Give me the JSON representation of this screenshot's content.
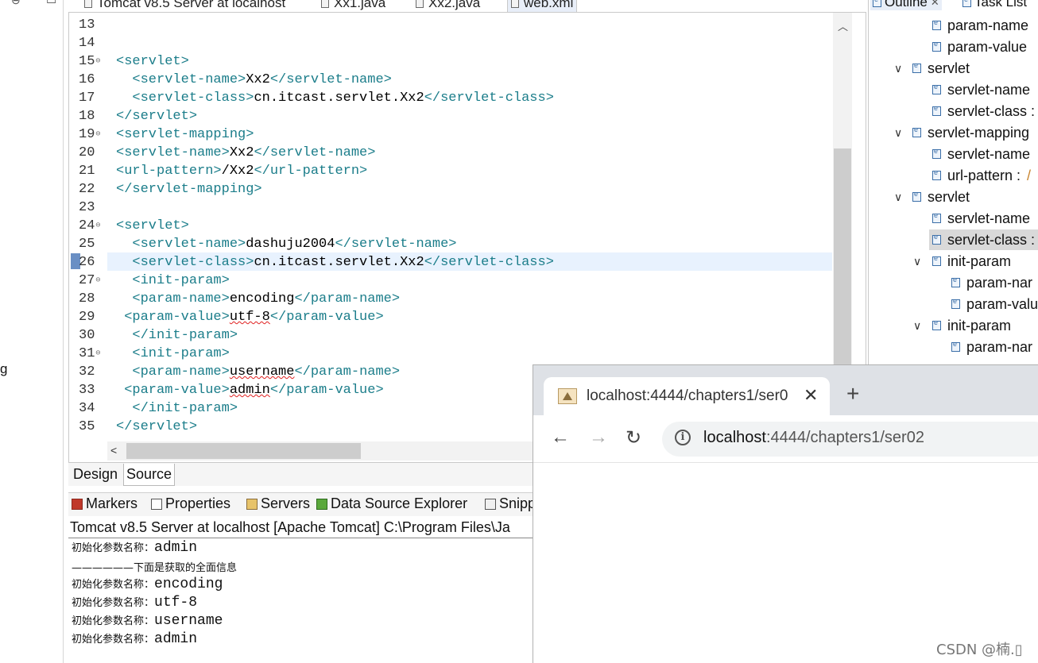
{
  "left_panel": {
    "cut_text": "g"
  },
  "editor_tabs": [
    {
      "label": "Tomcat v8.5 Server at localhost",
      "icon": "server-icon"
    },
    {
      "label": "Xx1.java",
      "icon": "java-file-icon"
    },
    {
      "label": "Xx2.java",
      "icon": "java-file-icon"
    },
    {
      "label": "web.xml",
      "icon": "xml-file-icon"
    }
  ],
  "editor": {
    "line_numbers": [
      "13",
      "14",
      "15",
      "16",
      "17",
      "18",
      "19",
      "20",
      "21",
      "22",
      "23",
      "24",
      "25",
      "26",
      "27",
      "28",
      "29",
      "30",
      "31",
      "32",
      "33",
      "34",
      "35"
    ],
    "fold_marker": "⊖",
    "lines": {
      "l15": {
        "t1": "<servlet>"
      },
      "l16": {
        "t1": "<servlet-name>",
        "v": "Xx2",
        "t2": "</servlet-name>"
      },
      "l17": {
        "t1": "<servlet-class>",
        "v": "cn.itcast.servlet.Xx2",
        "t2": "</servlet-class>"
      },
      "l18": {
        "t1": "</servlet>"
      },
      "l19": {
        "t1": "<servlet-mapping>"
      },
      "l20": {
        "t1": "<servlet-name>",
        "v": "Xx2",
        "t2": "</servlet-name>"
      },
      "l21": {
        "t1": "<url-pattern>",
        "v": "/Xx2",
        "t2": "</url-pattern>"
      },
      "l22": {
        "t1": "</servlet-mapping>"
      },
      "l24": {
        "t1": "<servlet>"
      },
      "l25": {
        "t1": "<servlet-name>",
        "v": "dashuju2004",
        "t2": "</servlet-name>"
      },
      "l26": {
        "t1": "<servlet-class>",
        "v": "cn.itcast.servlet.Xx2",
        "t2": "</servlet-class>"
      },
      "l27": {
        "t1": "<init-param>"
      },
      "l28": {
        "t1": "<param-name>",
        "v": "encoding",
        "t2": "</param-name>"
      },
      "l29": {
        "t1": "<param-value>",
        "v": "utf-8",
        "t2": "</param-value>"
      },
      "l30": {
        "t1": "</init-param>"
      },
      "l31": {
        "t1": "<init-param>"
      },
      "l32": {
        "t1": "<param-name>",
        "v": "username",
        "t2": "</param-name>"
      },
      "l33": {
        "t1": "<param-value>",
        "v": "admin",
        "t2": "</param-value>"
      },
      "l34": {
        "t1": "</init-param>"
      },
      "l35": {
        "t1": "</servlet>"
      }
    }
  },
  "design_source_tabs": {
    "design": "Design",
    "source": "Source"
  },
  "console": {
    "tabs": [
      {
        "label": "Markers",
        "icon": "markers-icon"
      },
      {
        "label": "Properties",
        "icon": "properties-icon"
      },
      {
        "label": "Servers",
        "icon": "servers-icon"
      },
      {
        "label": "Data Source Explorer",
        "icon": "data-source-icon"
      },
      {
        "label": "Snipp",
        "icon": "snippets-icon"
      }
    ],
    "title": "Tomcat v8.5 Server at localhost [Apache Tomcat] C:\\Program Files\\Ja",
    "lines": [
      {
        "label": "初始化参数名称：",
        "value": "admin"
      },
      {
        "label": "——————下面是获取的全面信息",
        "value": ""
      },
      {
        "label": "初始化参数名称：",
        "value": "encoding"
      },
      {
        "label": "初始化参数名称：",
        "value": "utf-8"
      },
      {
        "label": "初始化参数名称：",
        "value": "username"
      },
      {
        "label": "初始化参数名称：",
        "value": "admin"
      }
    ]
  },
  "outline": {
    "tabs": [
      {
        "label": "Outline",
        "icon": "outline-icon"
      },
      {
        "label": "Task List",
        "icon": "task-list-icon"
      }
    ],
    "rows": [
      {
        "label": "param-name",
        "suffix": ""
      },
      {
        "label": "param-value",
        "suffix": ""
      },
      {
        "label": "servlet",
        "suffix": ""
      },
      {
        "label": "servlet-name",
        "suffix": ""
      },
      {
        "label": "servlet-class :",
        "suffix": ""
      },
      {
        "label": "servlet-mapping",
        "suffix": ""
      },
      {
        "label": "servlet-name",
        "suffix": ""
      },
      {
        "label": "url-pattern :",
        "suffix": "/"
      },
      {
        "label": "servlet",
        "suffix": ""
      },
      {
        "label": "servlet-name",
        "suffix": ""
      },
      {
        "label": "servlet-class :",
        "suffix": ""
      },
      {
        "label": "init-param",
        "suffix": ""
      },
      {
        "label": "param-nar",
        "suffix": ""
      },
      {
        "label": "param-valu",
        "suffix": ""
      },
      {
        "label": "init-param",
        "suffix": ""
      },
      {
        "label": "param-nar",
        "suffix": ""
      }
    ]
  },
  "browser": {
    "tab_title": "localhost:4444/chapters1/ser0",
    "close_glyph": "✕",
    "new_tab_glyph": "+",
    "url_host": "localhost",
    "url_path": ":4444/chapters1/ser02",
    "info_glyph": "i",
    "back_glyph": "←",
    "forward_glyph": "→",
    "reload_glyph": "↻"
  },
  "watermark": "CSDN @楠.▯",
  "colors": {
    "xml_tag": "#1b7d8a",
    "line_highlight": "#e8f2fe",
    "selection": "#d9d9d9",
    "browser_tabstrip": "#dee1e6"
  }
}
